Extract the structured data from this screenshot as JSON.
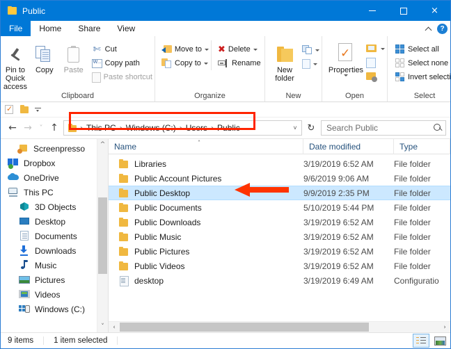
{
  "window": {
    "title": "Public",
    "controls": {
      "minimize": "–",
      "maximize": "□",
      "close": "×"
    }
  },
  "tabs": [
    {
      "label": "File",
      "active_file": true
    },
    {
      "label": "Home",
      "selected": true
    },
    {
      "label": "Share",
      "selected": false
    },
    {
      "label": "View",
      "selected": false
    }
  ],
  "ribbon_toggles": {
    "collapse": "collapse-ribbon",
    "help": "?"
  },
  "ribbon": {
    "groups": [
      {
        "title": "Clipboard",
        "big_buttons": [
          {
            "label": "Pin to Quick\naccess",
            "label_line1": "Pin to Quick",
            "label_line2": "access",
            "icon": "pin-icon",
            "disabled": false
          },
          {
            "label": "Copy",
            "icon": "copy-icon",
            "disabled": false
          },
          {
            "label": "Paste",
            "icon": "paste-icon",
            "disabled": true
          }
        ],
        "small_buttons": [
          {
            "label": "Cut",
            "icon": "scissors-icon",
            "disabled": false
          },
          {
            "label": "Copy path",
            "icon": "copy-path-icon",
            "disabled": false
          },
          {
            "label": "Paste shortcut",
            "icon": "paste-shortcut-icon",
            "disabled": true
          }
        ]
      },
      {
        "title": "Organize",
        "small_buttons": [
          {
            "label": "Move to",
            "icon": "move-to-icon",
            "has_caret": true
          },
          {
            "label": "Copy to",
            "icon": "copy-to-icon",
            "has_caret": true
          },
          {
            "label": "Delete",
            "icon": "delete-icon",
            "has_caret": true
          },
          {
            "label": "Rename",
            "icon": "rename-icon",
            "has_caret": false
          }
        ]
      },
      {
        "title": "New",
        "big_buttons": [
          {
            "label_line1": "New",
            "label_line2": "folder",
            "icon": "new-folder-icon"
          }
        ],
        "small_buttons": [
          {
            "label": "",
            "icon": "new-item-icon",
            "has_caret": true
          },
          {
            "label": "",
            "icon": "easy-access-icon",
            "has_caret": true
          }
        ]
      },
      {
        "title": "Open",
        "big_buttons": [
          {
            "label": "Properties",
            "icon": "properties-icon",
            "has_caret": true
          }
        ],
        "small_buttons": [
          {
            "label": "",
            "icon": "open-folder-icon",
            "has_caret": true
          },
          {
            "label": "",
            "icon": "edit-icon",
            "has_caret": false
          },
          {
            "label": "",
            "icon": "history-icon",
            "has_caret": false
          }
        ]
      },
      {
        "title": "Select",
        "small_buttons": [
          {
            "label": "Select all",
            "icon": "select-all-icon"
          },
          {
            "label": "Select none",
            "icon": "select-none-icon"
          },
          {
            "label": "Invert selection",
            "icon": "invert-selection-icon"
          }
        ]
      }
    ]
  },
  "quick_access_toolbar": [
    {
      "icon": "properties-icon"
    },
    {
      "icon": "new-folder-icon"
    },
    {
      "icon": "customize-dropdown-icon"
    }
  ],
  "navigation": {
    "back": "←",
    "forward": "→",
    "recent_locations": "˅",
    "up": "↑",
    "refresh": "↻",
    "breadcrumb_dropdown": "˅"
  },
  "address_bar": {
    "crumbs": [
      "This PC",
      "Windows (C:)",
      "Users",
      "Public"
    ],
    "separator": "›"
  },
  "search": {
    "placeholder": "Search Public"
  },
  "sidebar": {
    "items": [
      {
        "label": "Screenpresso",
        "icon": "screenpresso-icon",
        "indent": 1
      },
      {
        "label": "Dropbox",
        "icon": "dropbox-icon",
        "indent": 0
      },
      {
        "label": "OneDrive",
        "icon": "onedrive-icon",
        "indent": 0
      },
      {
        "label": "This PC",
        "icon": "this-pc-icon",
        "indent": 0
      },
      {
        "label": "3D Objects",
        "icon": "3d-objects-icon",
        "indent": 1
      },
      {
        "label": "Desktop",
        "icon": "desktop-icon",
        "indent": 1
      },
      {
        "label": "Documents",
        "icon": "documents-icon",
        "indent": 1
      },
      {
        "label": "Downloads",
        "icon": "downloads-icon",
        "indent": 1
      },
      {
        "label": "Music",
        "icon": "music-icon",
        "indent": 1
      },
      {
        "label": "Pictures",
        "icon": "pictures-icon",
        "indent": 1
      },
      {
        "label": "Videos",
        "icon": "videos-icon",
        "indent": 1
      },
      {
        "label": "Windows (C:)",
        "icon": "windows-drive-icon",
        "indent": 1
      }
    ]
  },
  "file_list": {
    "columns": [
      "Name",
      "Date modified",
      "Type"
    ],
    "sort_indicator": "˄",
    "rows": [
      {
        "name": "Libraries",
        "date": "3/19/2019 6:52 AM",
        "type": "File folder",
        "icon": "folder-icon",
        "selected": false
      },
      {
        "name": "Public Account Pictures",
        "date": "9/6/2019 9:06 AM",
        "type": "File folder",
        "icon": "folder-icon",
        "selected": false
      },
      {
        "name": "Public Desktop",
        "date": "9/9/2019 2:35 PM",
        "type": "File folder",
        "icon": "folder-icon",
        "selected": true
      },
      {
        "name": "Public Documents",
        "date": "5/10/2019 5:44 PM",
        "type": "File folder",
        "icon": "folder-icon",
        "selected": false
      },
      {
        "name": "Public Downloads",
        "date": "3/19/2019 6:52 AM",
        "type": "File folder",
        "icon": "folder-icon",
        "selected": false
      },
      {
        "name": "Public Music",
        "date": "3/19/2019 6:52 AM",
        "type": "File folder",
        "icon": "folder-icon",
        "selected": false
      },
      {
        "name": "Public Pictures",
        "date": "3/19/2019 6:52 AM",
        "type": "File folder",
        "icon": "folder-icon",
        "selected": false
      },
      {
        "name": "Public Videos",
        "date": "3/19/2019 6:52 AM",
        "type": "File folder",
        "icon": "folder-icon",
        "selected": false
      },
      {
        "name": "desktop",
        "date": "3/19/2019 6:49 AM",
        "type": "Configuratio",
        "icon": "config-file-icon",
        "selected": false
      }
    ]
  },
  "status_bar": {
    "item_count": "9 items",
    "selection": "1 item selected",
    "views": [
      {
        "name": "details-view",
        "active": true
      },
      {
        "name": "large-icons-view",
        "active": false
      }
    ]
  },
  "annotations": {
    "breadcrumb_highlight_color": "#ff2400",
    "arrow_color": "#ff3300",
    "arrow_target": "Public Desktop"
  },
  "colors": {
    "titlebar": "#0078d7",
    "selection": "#cce8ff",
    "folder": "#f0b840",
    "header_text": "#26527d"
  }
}
